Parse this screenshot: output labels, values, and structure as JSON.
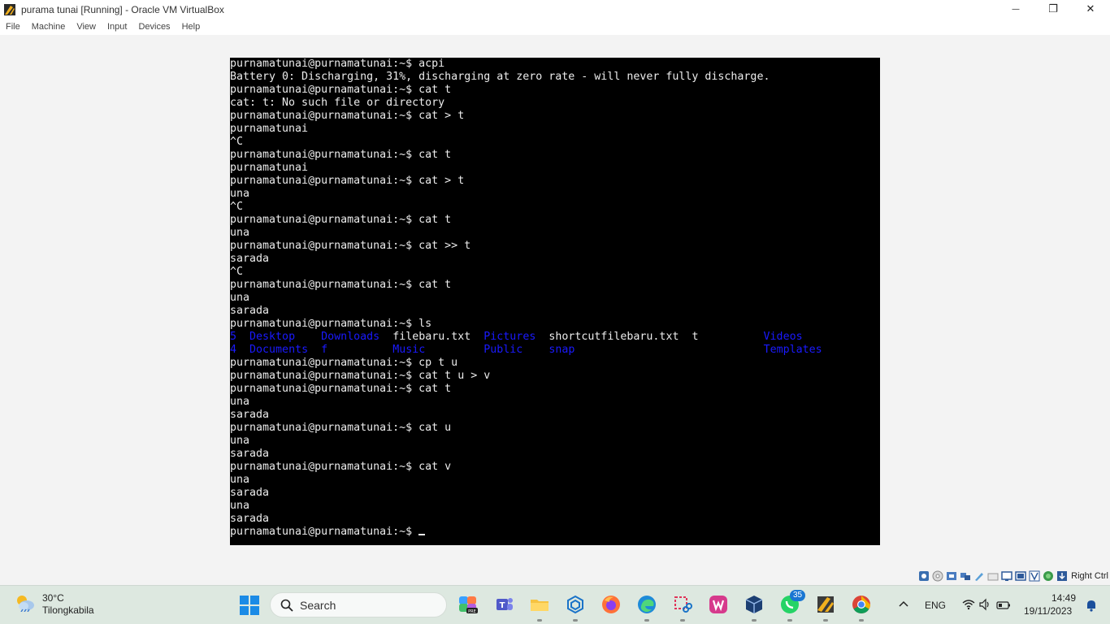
{
  "window": {
    "title": "purama tunai [Running] - Oracle VM VirtualBox",
    "minimize_glyph": "—",
    "restore_glyph": "❐",
    "close_glyph": "✕"
  },
  "menu": [
    "File",
    "Machine",
    "View",
    "Input",
    "Devices",
    "Help"
  ],
  "terminal": {
    "lines": [
      "purnamatunai@purnamatunai:~$ acpi",
      "Battery 0: Discharging, 31%, discharging at zero rate - will never fully discharge.",
      "purnamatunai@purnamatunai:~$ cat t",
      "cat: t: No such file or directory",
      "purnamatunai@purnamatunai:~$ cat > t",
      "purnamatunai",
      "^C",
      "purnamatunai@purnamatunai:~$ cat t",
      "purnamatunai",
      "purnamatunai@purnamatunai:~$ cat > t",
      "una",
      "^C",
      "purnamatunai@purnamatunai:~$ cat t",
      "una",
      "purnamatunai@purnamatunai:~$ cat >> t",
      "sarada",
      "^C",
      "purnamatunai@purnamatunai:~$ cat t",
      "una",
      "sarada",
      "purnamatunai@purnamatunai:~$ ls"
    ],
    "ls_row1": [
      "5",
      "Desktop",
      "Downloads",
      "filebaru.txt",
      "Pictures",
      "shortcutfilebaru.txt",
      "t",
      "Videos"
    ],
    "ls_row2": [
      "4",
      "Documents",
      "f",
      "Music",
      "Public",
      "snap",
      "",
      "Templates"
    ],
    "lines_after": [
      "purnamatunai@purnamatunai:~$ cp t u",
      "purnamatunai@purnamatunai:~$ cat t u > v",
      "purnamatunai@purnamatunai:~$ cat t",
      "una",
      "sarada",
      "purnamatunai@purnamatunai:~$ cat u",
      "una",
      "sarada",
      "purnamatunai@purnamatunai:~$ cat v",
      "una",
      "sarada",
      "una",
      "sarada"
    ],
    "prompt": "purnamatunai@purnamatunai:~$ "
  },
  "status_bar": {
    "host_key": "Right Ctrl",
    "icons": [
      "hard-disk-icon",
      "optical-drive-icon",
      "audio-icon",
      "network-icon",
      "usb-icon",
      "shared-folders-icon",
      "display-icon",
      "video-capture-icon",
      "guest-additions-icon",
      "cpu-icon",
      "mouse-integration-icon",
      "keyboard-icon"
    ]
  },
  "taskbar": {
    "weather": {
      "temp": "30°C",
      "location": "Tilongkabila"
    },
    "search_label": "Search",
    "apps": [
      "copilot-app-icon",
      "teams-app-icon",
      "file-explorer-app-icon",
      "vscode-app-icon",
      "firefox-app-icon",
      "edge-app-icon",
      "snipping-tool-app-icon",
      "wps-office-app-icon",
      "virtualbox-app-icon",
      "whatsapp-app-icon",
      "winrar-app-icon",
      "chrome-app-icon"
    ],
    "whatsapp_badge": "35",
    "language": "ENG",
    "time": "14:49",
    "date": "19/11/2023"
  },
  "colors": {
    "terminal_bg": "#000000",
    "terminal_fg": "#ececec",
    "ls_dir_color": "#1a1aff",
    "taskbar_bg": "#dde8e0"
  }
}
